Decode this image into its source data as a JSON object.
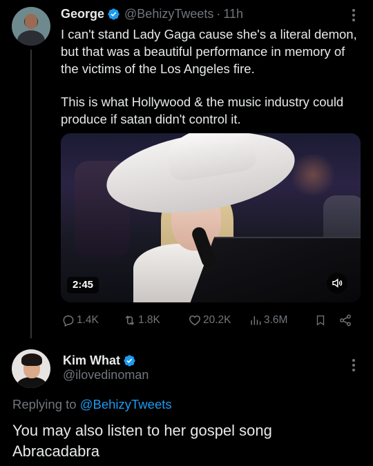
{
  "tweet1": {
    "author_name": "George",
    "handle": "@BehizyTweets",
    "separator": "·",
    "time": "11h",
    "text_paragraph1": "I can't stand Lady Gaga cause she's a literal demon, but that was a beautiful performance in memory of the victims of the Los Angeles fire.",
    "text_paragraph2": "This is what Hollywood & the music industry could produce if satan didn't control it.",
    "video_duration": "2:45",
    "stats": {
      "replies": "1.4K",
      "reposts": "1.8K",
      "likes": "20.2K",
      "views": "3.6M"
    }
  },
  "tweet2": {
    "author_name": "Kim What",
    "handle": "@ilovedinoman",
    "replying_prefix": "Replying to",
    "replying_to": "@BehizyTweets",
    "text": "You may also listen to her gospel song Abracadabra"
  },
  "colors": {
    "background": "#000000",
    "text": "#e7e9ea",
    "muted": "#71767b",
    "accent": "#1d9bf0",
    "thread_line": "#333639"
  },
  "icons": [
    "verified-badge-icon",
    "more-icon",
    "reply-icon",
    "repost-icon",
    "like-icon",
    "views-icon",
    "bookmark-icon",
    "share-icon",
    "volume-icon"
  ]
}
